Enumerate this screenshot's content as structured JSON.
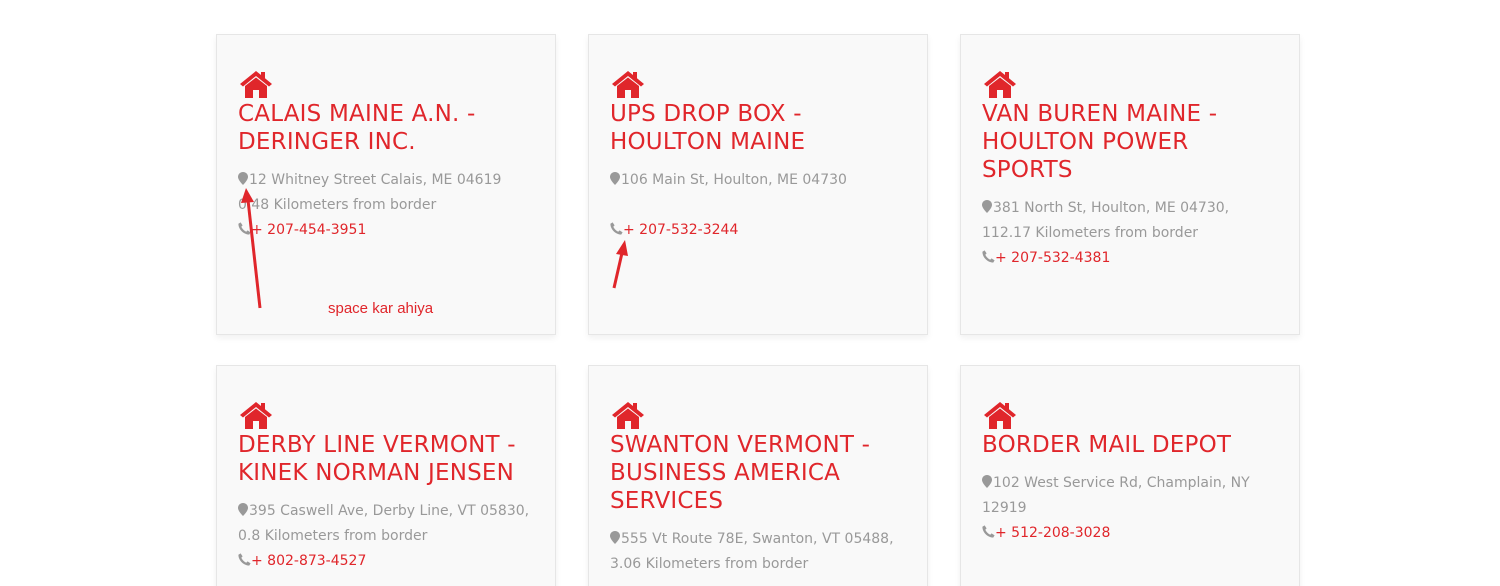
{
  "colors": {
    "accent": "#e0262b",
    "muted_text": "#999999",
    "card_bg": "#f9f9f9",
    "card_border": "#e6e6e6"
  },
  "icons": {
    "home": "home-icon",
    "pin": "map-pin-icon",
    "phone": "phone-icon"
  },
  "cards": [
    {
      "title": "CALAIS MAINE A.N. - DERINGER INC.",
      "address": "12 Whitney Street Calais, ME 04619 0.48 Kilometers from border",
      "phone": "+ 207-454-3951"
    },
    {
      "title": "UPS DROP BOX - HOULTON MAINE",
      "address": "106 Main St, Houlton, ME 04730",
      "phone": "+ 207-532-3244"
    },
    {
      "title": "VAN BUREN MAINE - HOULTON POWER SPORTS",
      "address": "381 North St, Houlton, ME 04730, 112.17 Kilometers from border",
      "phone": "+ 207-532-4381"
    },
    {
      "title": "DERBY LINE VERMONT - KINEK NORMAN JENSEN",
      "address": "395 Caswell Ave, Derby Line, VT 05830, 0.8 Kilometers from border",
      "phone": "+ 802-873-4527"
    },
    {
      "title": "SWANTON VERMONT - BUSINESS AMERICA SERVICES",
      "address": "555 Vt Route 78E, Swanton, VT 05488, 3.06 Kilometers from border",
      "phone": ""
    },
    {
      "title": "BORDER MAIL DEPOT",
      "address": "102 West Service Rd, Champlain, NY 12919",
      "phone": "+ 512-208-3028"
    }
  ],
  "annotation": {
    "note": "space kar ahiya"
  }
}
